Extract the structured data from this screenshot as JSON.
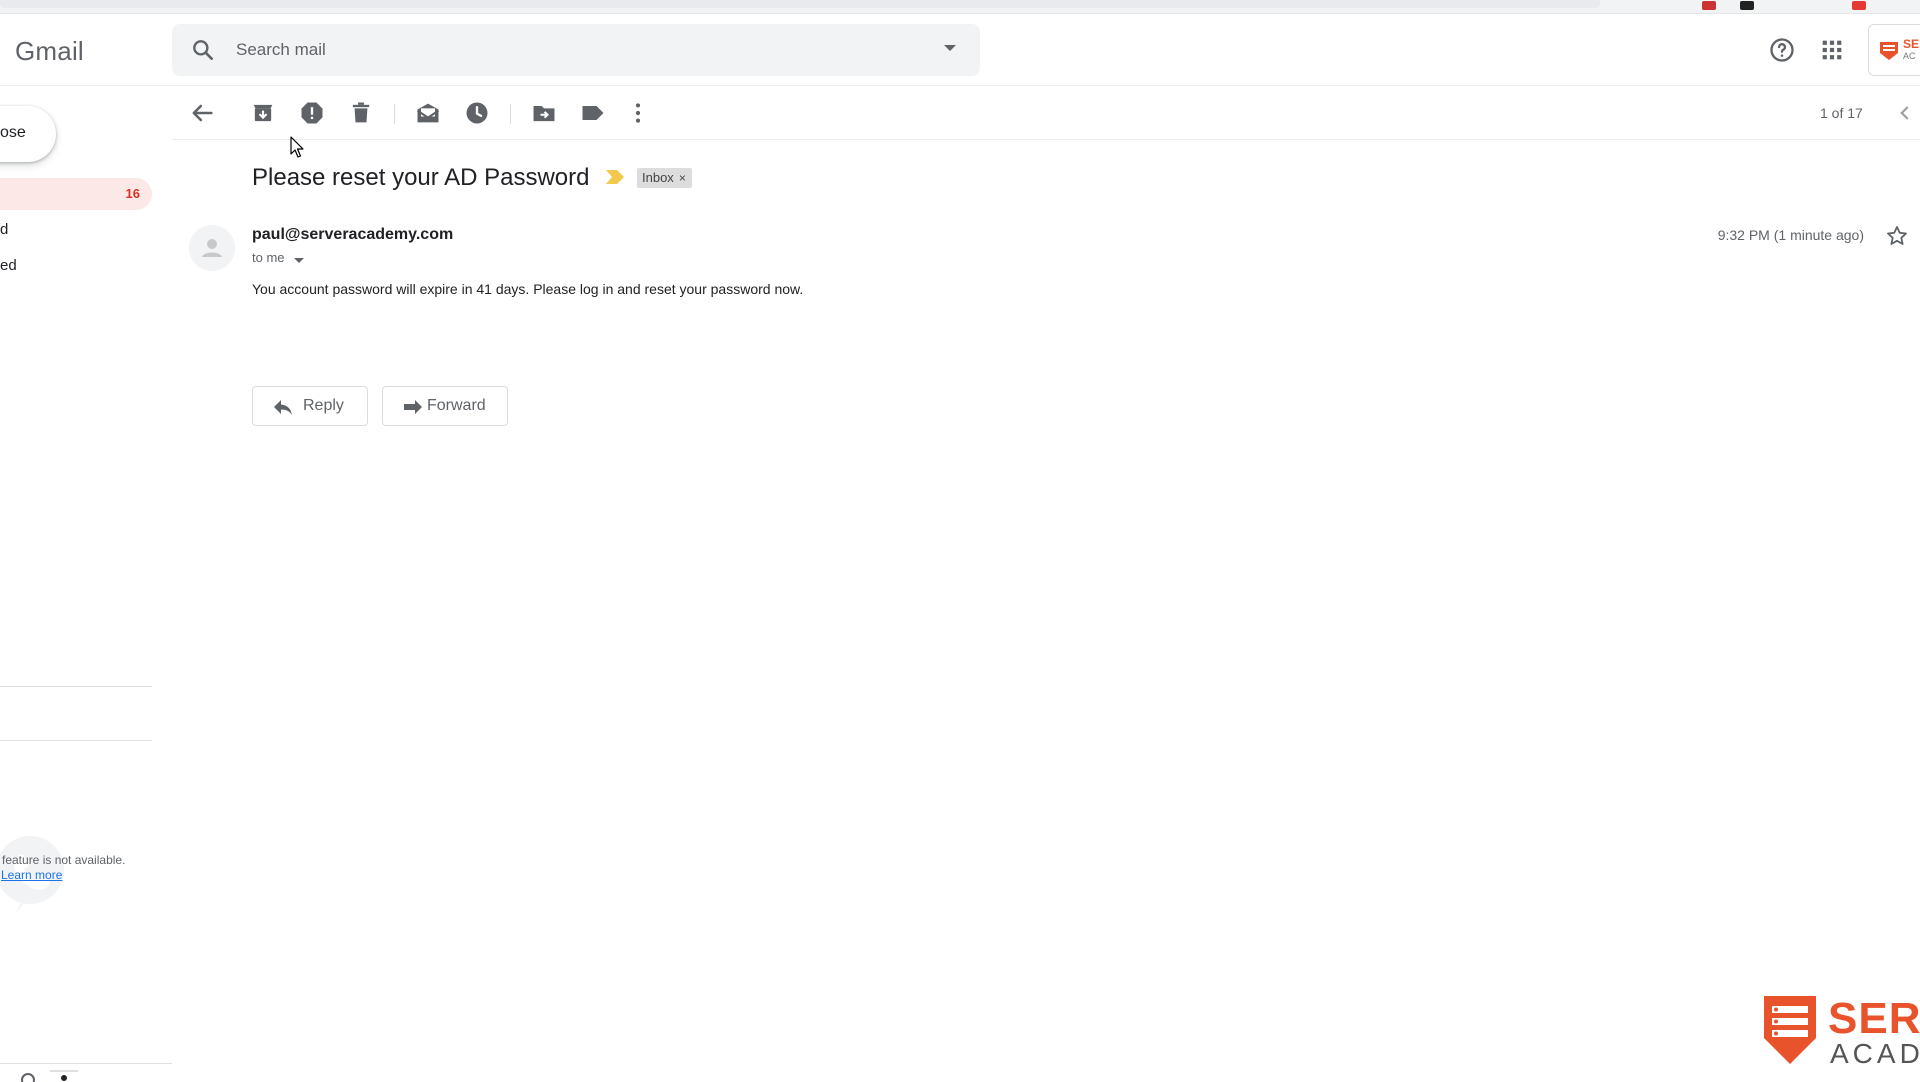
{
  "app": {
    "name": "Gmail"
  },
  "search": {
    "placeholder": "Search mail"
  },
  "sidebar": {
    "compose_label": "ose",
    "items": [
      {
        "label": "",
        "count": "16",
        "active": true
      },
      {
        "label": "d"
      },
      {
        "label": "ed"
      }
    ],
    "hangouts_note": "feature is not available.",
    "learn_more": "Learn more"
  },
  "toolbar": {
    "pager": "1 of 17"
  },
  "message": {
    "subject": "Please reset your AD Password",
    "label_chip": "Inbox",
    "label_chip_remove": "×",
    "sender": "paul@serveracademy.com",
    "recipients": "to me",
    "timestamp": "9:32 PM (1 minute ago)",
    "body": "You account password will expire in 41 days. Please log in and reset your password now.",
    "reply_label": "Reply",
    "forward_label": "Forward"
  },
  "icons": {
    "search": "search-icon",
    "help": "help-icon",
    "apps": "apps-grid-icon",
    "back": "back-arrow-icon",
    "archive": "archive-icon",
    "spam": "report-spam-icon",
    "delete": "trash-icon",
    "mark_unread": "mark-unread-icon",
    "snooze": "snooze-clock-icon",
    "move": "move-to-folder-icon",
    "labels": "label-icon",
    "more": "more-vert-icon",
    "star": "star-icon",
    "importance": "importance-marker-icon"
  },
  "colors": {
    "accent_red": "#d93025",
    "active_bg": "#fce8e6",
    "importance": "#f2c94c",
    "brand_orange": "#e8532b"
  }
}
